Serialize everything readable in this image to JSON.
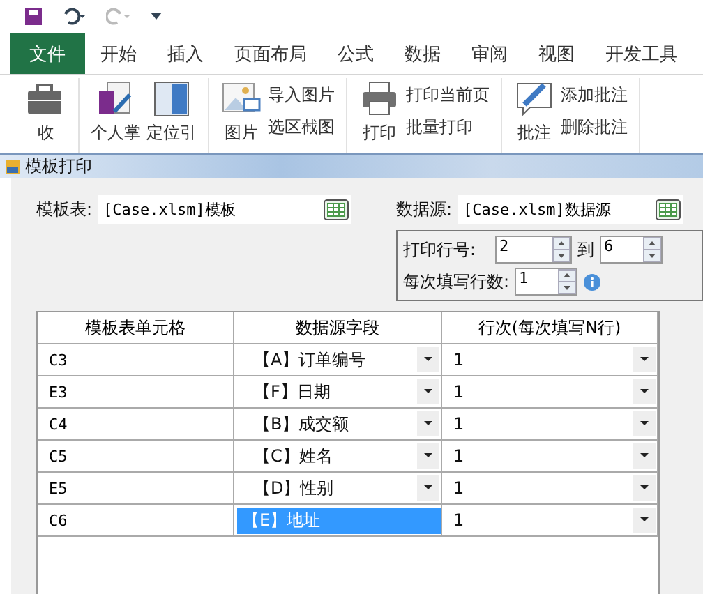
{
  "tabs": [
    {
      "label": "文件",
      "selected": true
    },
    {
      "label": "开始",
      "selected": false
    },
    {
      "label": "插入",
      "selected": false
    },
    {
      "label": "页面布局",
      "selected": false
    },
    {
      "label": "公式",
      "selected": false
    },
    {
      "label": "数据",
      "selected": false
    },
    {
      "label": "审阅",
      "selected": false
    },
    {
      "label": "视图",
      "selected": false
    },
    {
      "label": "开发工具",
      "selected": false
    }
  ],
  "ribbon": [
    {
      "large": [
        {
          "label": "收",
          "kind": "toolbox"
        }
      ]
    },
    {
      "large": [
        {
          "label": "个人掌",
          "kind": "notebook"
        },
        {
          "label": "定位引",
          "kind": "panel"
        }
      ]
    },
    {
      "large": [
        {
          "label": "图片",
          "kind": "image"
        }
      ],
      "small": [
        "导入图片",
        "选区截图"
      ]
    },
    {
      "large": [
        {
          "label": "打印",
          "kind": "printer"
        }
      ],
      "small": [
        "打印当前页",
        "批量打印"
      ]
    },
    {
      "large": [
        {
          "label": "批注",
          "kind": "comment"
        }
      ],
      "small": [
        "添加批注",
        "删除批注"
      ]
    }
  ],
  "dialog": {
    "title": "模板打印",
    "template": {
      "label": "模板表:",
      "value": "[Case.xlsm]模板"
    },
    "source": {
      "label": "数据源:",
      "value": "[Case.xlsm]数据源"
    },
    "print_rows": {
      "label": "打印行号:",
      "from": "2",
      "to_label": "到",
      "to": "6"
    },
    "per_fill": {
      "label": "每次填写行数:",
      "value": "1"
    },
    "table": {
      "columns": [
        "模板表单元格",
        "数据源字段",
        "行次(每次填写N行)"
      ],
      "rows": [
        {
          "cell": "C3",
          "field": "【A】订单编号",
          "line": "1",
          "selected": false
        },
        {
          "cell": "E3",
          "field": "【F】日期",
          "line": "1",
          "selected": false
        },
        {
          "cell": "C4",
          "field": "【B】成交额",
          "line": "1",
          "selected": false
        },
        {
          "cell": "C5",
          "field": "【C】姓名",
          "line": "1",
          "selected": false
        },
        {
          "cell": "E5",
          "field": "【D】性别",
          "line": "1",
          "selected": false
        },
        {
          "cell": "C6",
          "field": "【E】地址",
          "line": "1",
          "selected": true
        }
      ]
    }
  }
}
